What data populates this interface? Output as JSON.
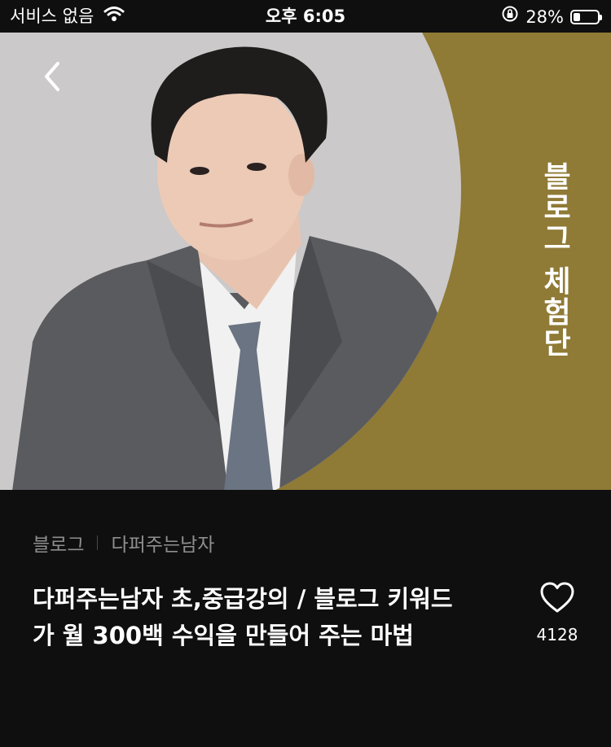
{
  "status_bar": {
    "carrier": "서비스 없음",
    "time": "오후 6:05",
    "battery_percent": "28%",
    "battery_level": 0.28,
    "icons": [
      "wifi-icon",
      "rotation-lock-icon",
      "battery-icon"
    ]
  },
  "hero": {
    "title": "블로그 체험단",
    "back_icon": "chevron-left-icon",
    "colors": {
      "background": "#8f7a36",
      "circle": "#cbc9c9"
    }
  },
  "product": {
    "breadcrumb": [
      "블로그",
      "다퍼주는남자"
    ],
    "title": "다퍼주는남자 초,중급강의 / 블로그 키워드가 월 300백 수익을 만들어 주는 마법",
    "likes": "4128",
    "like_icon": "heart-outline-icon"
  }
}
